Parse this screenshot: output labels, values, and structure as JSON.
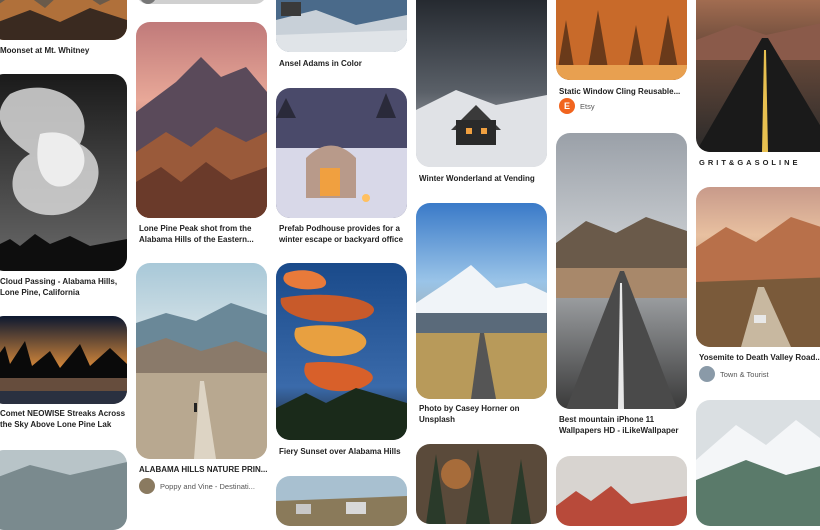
{
  "pins": {
    "moonset": {
      "title": "Moonset at Mt. Whitney"
    },
    "cloud": {
      "title": "Cloud Passing - Alabama Hills,\nLone Pine, California"
    },
    "comet": {
      "title": "Comet NEOWISE Streaks Across\nthe Sky Above Lone Pine Lak"
    },
    "lonepine": {
      "title": "Lone Pine Peak shot from the\nAlabama Hills of the Eastern..."
    },
    "alabama_nature": {
      "title": "ALABAMA HILLS NATURE PRIN...",
      "source": "Poppy and Vine - Destinati..."
    },
    "ansel": {
      "title": "Ansel Adams in Color"
    },
    "podhouse": {
      "title": "Prefab Podhouse provides for a\nwinter escape or backyard office"
    },
    "fiery": {
      "title": "Fiery Sunset over Alabama Hills"
    },
    "winter": {
      "title": "Winter Wonderland at Vending"
    },
    "casey": {
      "title": "Photo by Casey Horner on\nUnsplash"
    },
    "cling": {
      "title": "Static Window Cling Reusable...",
      "source": "Etsy",
      "source_initial": "E"
    },
    "iphone": {
      "title": "Best mountain iPhone 11\nWallpapers HD - iLikeWallpaper"
    },
    "grit": {
      "brand": "GRIT&GASOLINE"
    },
    "yosemite": {
      "title": "Yosemite to Death Valley Road...",
      "source": "Town & Tourist"
    }
  }
}
